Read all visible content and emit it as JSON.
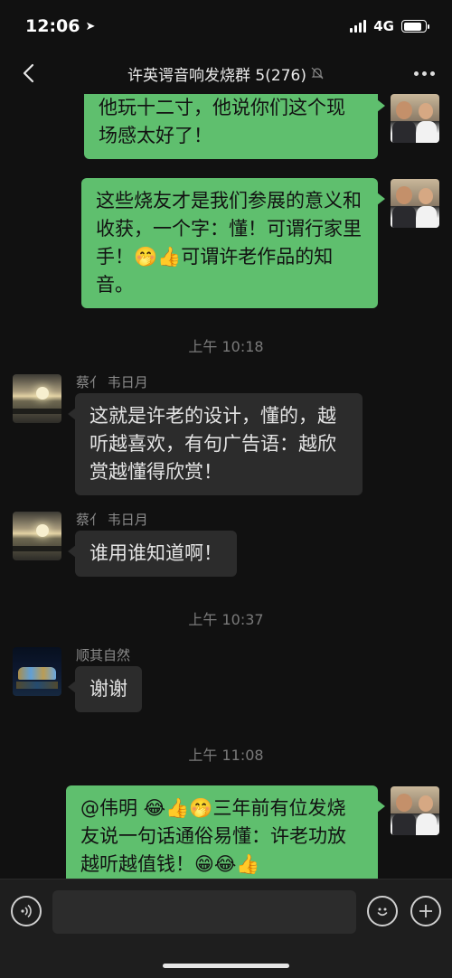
{
  "status_bar": {
    "time": "12:06",
    "network": "4G"
  },
  "header": {
    "title": "许英谔音响发烧群 5(276)"
  },
  "messages": [
    {
      "type": "out",
      "text": "他玩十二寸，他说你们这个现场感太好了！"
    },
    {
      "type": "out",
      "text": "这些烧友才是我们参展的意义和收获，一个字：懂！可谓行家里手！🤭👍可谓许老作品的知音。"
    },
    {
      "type": "time",
      "text": "上午 10:18"
    },
    {
      "type": "in",
      "sender": "蔡亻 韦日月",
      "text": "这就是许老的设计，懂的，越听越喜欢，有句广告语：越欣赏越懂得欣赏！"
    },
    {
      "type": "in",
      "sender": "蔡亻 韦日月",
      "text": "谁用谁知道啊！"
    },
    {
      "type": "time",
      "text": "上午 10:37"
    },
    {
      "type": "in",
      "sender": "顺其自然",
      "text": "谢谢"
    },
    {
      "type": "time",
      "text": "上午 11:08"
    },
    {
      "type": "out",
      "text": "@伟明 😂👍🤭三年前有位发烧友说一句话通俗易懂：许老功放越听越值钱！😁😂👍"
    }
  ],
  "input": {
    "value": ""
  },
  "colors": {
    "outgoing": "#5fbf6e",
    "incoming": "#2c2c2c",
    "background": "#111111"
  },
  "icons": [
    "back-icon",
    "mute-bell-icon",
    "more-icon",
    "voice-icon",
    "emoji-icon",
    "plus-icon"
  ]
}
